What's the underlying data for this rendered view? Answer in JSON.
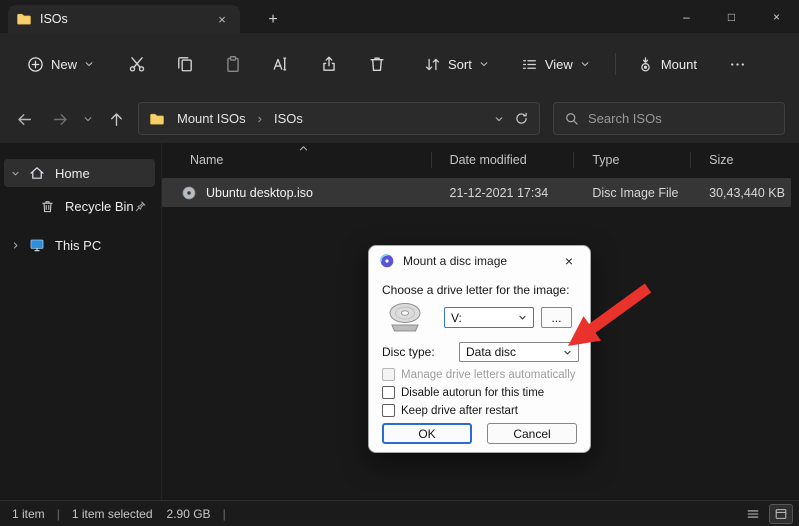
{
  "window": {
    "tab_title": "ISOs",
    "tab_close_glyph": "×",
    "new_tab_glyph": "+",
    "minimize_glyph": "–",
    "maximize_glyph": "□",
    "close_glyph": "×"
  },
  "toolbar": {
    "new_label": "New",
    "sort_label": "Sort",
    "view_label": "View",
    "mount_label": "Mount"
  },
  "address_bar": {
    "breadcrumb": [
      "Mount ISOs",
      "ISOs"
    ],
    "separator": "›",
    "search_placeholder": "Search ISOs"
  },
  "sidebar": {
    "items": [
      {
        "label": "Home"
      },
      {
        "label": "Recycle Bin"
      },
      {
        "label": "This PC"
      }
    ]
  },
  "file_list": {
    "columns": [
      "Name",
      "Date modified",
      "Type",
      "Size"
    ],
    "rows": [
      {
        "name": "Ubuntu desktop.iso",
        "date_modified": "21-12-2021 17:34",
        "type": "Disc Image File",
        "size": "30,43,440 KB"
      }
    ]
  },
  "status_bar": {
    "item_count": "1 item",
    "divider": "|",
    "selection": "1 item selected",
    "selection_size": "2.90 GB"
  },
  "dialog": {
    "title": "Mount a disc image",
    "close_glyph": "×",
    "drive_letter_label": "Choose a drive letter for the image:",
    "drive_letter_value": "V:",
    "browse_label": "...",
    "disc_type_label": "Disc type:",
    "disc_type_value": "Data disc",
    "checkboxes": [
      {
        "label": "Manage drive letters automatically",
        "checked": false,
        "disabled": true
      },
      {
        "label": "Disable autorun for this time",
        "checked": false,
        "disabled": false
      },
      {
        "label": "Keep drive after restart",
        "checked": false,
        "disabled": false
      }
    ],
    "ok_label": "OK",
    "cancel_label": "Cancel"
  }
}
